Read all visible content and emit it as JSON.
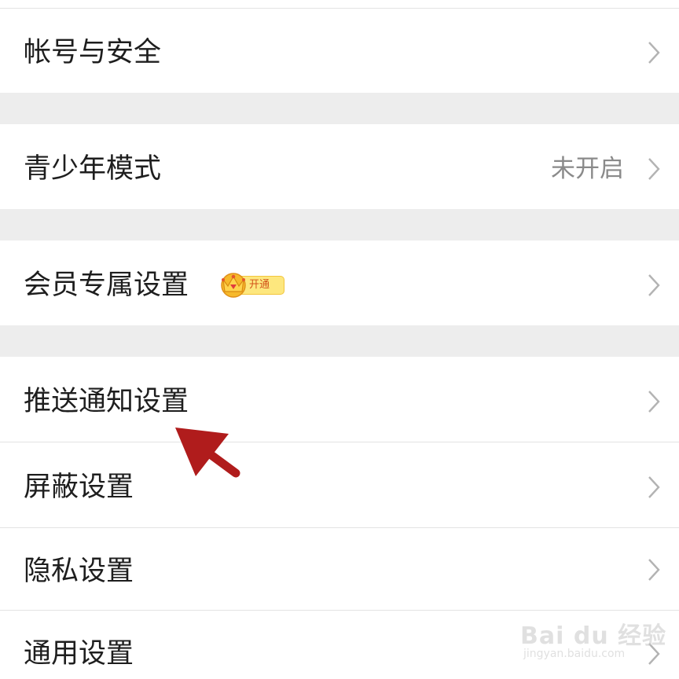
{
  "settings": {
    "items": [
      {
        "label": "帐号与安全",
        "value": ""
      },
      {
        "label": "青少年模式",
        "value": "未开启"
      },
      {
        "label": "会员专属设置",
        "value": "",
        "badge": {
          "text": "开通",
          "icon": "crown-icon"
        }
      },
      {
        "label": "推送通知设置",
        "value": ""
      },
      {
        "label": "屏蔽设置",
        "value": ""
      },
      {
        "label": "隐私设置",
        "value": ""
      },
      {
        "label": "通用设置",
        "value": ""
      }
    ]
  },
  "annotation": {
    "arrow_color": "#b01c1c",
    "points_to": "推送通知设置"
  },
  "watermark": {
    "brand": "Bai du 经验",
    "url": "jingyan.baidu.com"
  },
  "colors": {
    "background": "#ededed",
    "row": "#ffffff",
    "text": "#1e1e1e",
    "secondary_text": "#8a8a8a",
    "chevron": "#b3b3b3",
    "vip_badge": "#fde77e"
  }
}
